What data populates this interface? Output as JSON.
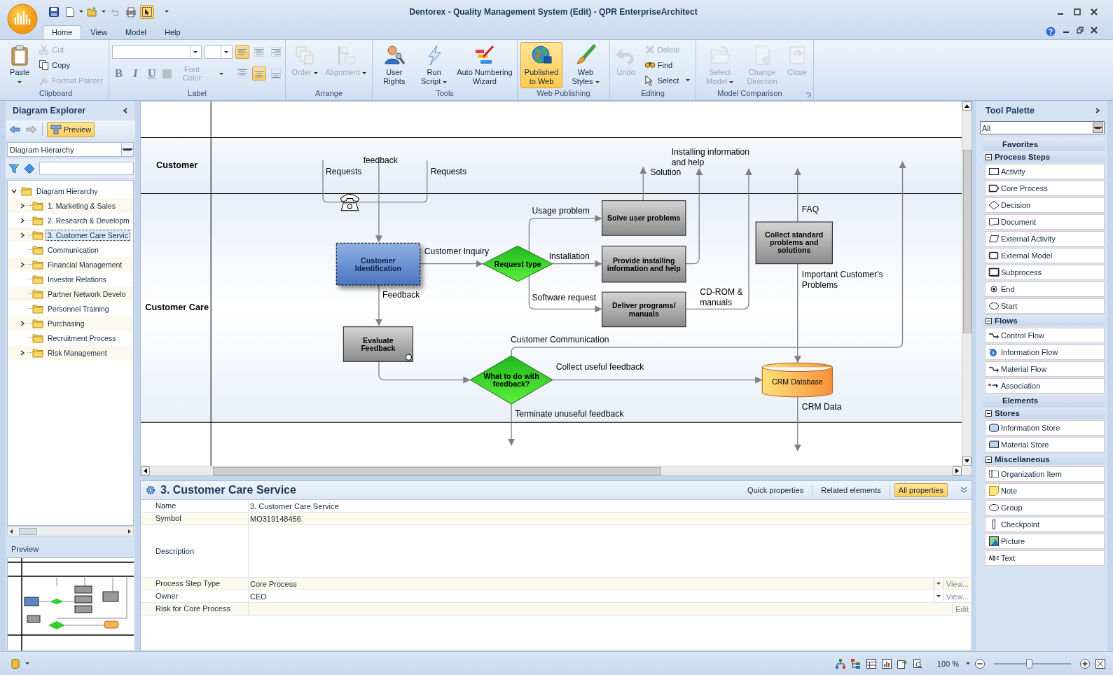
{
  "window": {
    "title": "Dentorex - Quality Management System (Edit) - QPR EnterpriseArchitect"
  },
  "quick_access": [
    {
      "disabled": false,
      "on": false
    },
    {
      "disabled": false,
      "on": false
    },
    {
      "disabled": false,
      "on": false
    },
    {
      "disabled": true,
      "on": false
    },
    {
      "disabled": false,
      "on": false
    },
    {
      "disabled": false,
      "on": true
    }
  ],
  "ribbon": {
    "tabs": [
      {
        "label": "Home",
        "selected": true
      },
      {
        "label": "View",
        "selected": false
      },
      {
        "label": "Model",
        "selected": false
      },
      {
        "label": "Help",
        "selected": false
      }
    ],
    "groups": [
      {
        "title": "Clipboard",
        "kind": "buttons",
        "buttons": [
          {
            "label": "Paste",
            "kind": "large",
            "disabled": false,
            "on": false,
            "dropdown": true
          },
          {
            "label": "Cut",
            "kind": "small",
            "disabled": true,
            "on": false,
            "dropdown": false
          },
          {
            "label": "Copy",
            "kind": "small",
            "disabled": false,
            "on": false,
            "dropdown": false
          },
          {
            "label": "Format Painter",
            "kind": "small",
            "disabled": true,
            "on": false,
            "dropdown": false
          }
        ]
      },
      {
        "title": "Label",
        "kind": "format",
        "styles": [
          {
            "label": "B",
            "disabled": true
          },
          {
            "label": "I",
            "disabled": true
          },
          {
            "label": "U",
            "disabled": true
          }
        ],
        "font_color": {
          "label": "Font Color",
          "disabled": true
        },
        "h_align": [
          {
            "selected": true
          },
          {
            "selected": false
          },
          {
            "selected": false
          }
        ],
        "v_align": [
          {
            "selected": false
          },
          {
            "selected": true
          },
          {
            "selected": false
          }
        ]
      },
      {
        "title": "Arrange",
        "kind": "buttons",
        "buttons": [
          {
            "label": "Order",
            "kind": "large",
            "disabled": true,
            "on": false,
            "dropdown": true
          },
          {
            "label": "Alignment",
            "kind": "large",
            "disabled": true,
            "on": false,
            "dropdown": true
          }
        ]
      },
      {
        "title": "Tools",
        "kind": "buttons",
        "buttons": [
          {
            "label": "User Rights",
            "kind": "large",
            "disabled": false,
            "on": false,
            "dropdown": false
          },
          {
            "label": "Run Script",
            "kind": "large",
            "disabled": false,
            "on": false,
            "dropdown": true
          },
          {
            "label": "Auto Numbering Wizard",
            "kind": "large",
            "disabled": false,
            "on": false,
            "dropdown": false
          }
        ]
      },
      {
        "title": "Web Publishing",
        "kind": "buttons",
        "buttons": [
          {
            "label": "Published to Web",
            "kind": "large",
            "disabled": false,
            "on": true,
            "dropdown": false
          },
          {
            "label": "Web Styles",
            "kind": "large",
            "disabled": false,
            "on": false,
            "dropdown": true
          }
        ]
      },
      {
        "title": "Editing",
        "kind": "buttons",
        "buttons": [
          {
            "label": "Undo",
            "kind": "large",
            "disabled": true,
            "on": false,
            "dropdown": false
          },
          {
            "label": "Delete",
            "kind": "small",
            "disabled": true,
            "on": false,
            "dropdown": false
          },
          {
            "label": "Find",
            "kind": "small",
            "disabled": false,
            "on": false,
            "dropdown": false
          },
          {
            "label": "Select",
            "kind": "small",
            "disabled": false,
            "on": false,
            "dropdown": true
          }
        ]
      },
      {
        "title": "Model Comparison",
        "kind": "buttons",
        "buttons": [
          {
            "label": "Select Model",
            "kind": "large",
            "disabled": true,
            "on": false,
            "dropdown": true
          },
          {
            "label": "Change Direction",
            "kind": "large",
            "disabled": true,
            "on": false,
            "dropdown": false
          },
          {
            "label": "Close",
            "kind": "large",
            "disabled": true,
            "on": false,
            "dropdown": false
          }
        ]
      }
    ]
  },
  "explorer": {
    "title": "Diagram Explorer",
    "preview_button": {
      "label": "Preview",
      "on": true
    },
    "view": {
      "value": "Diagram Hierarchy"
    },
    "tree": [
      {
        "label": "Diagram Hierarchy",
        "kind": "branch",
        "expanded": true,
        "selected": false,
        "children": [
          {
            "label": "1. Marketing & Sales",
            "kind": "branch",
            "expanded": false,
            "selected": false
          },
          {
            "label": "2. Research & Developm",
            "kind": "branch",
            "expanded": false,
            "selected": false
          },
          {
            "label": "3. Customer Care Servic",
            "kind": "branch",
            "expanded": false,
            "selected": true
          },
          {
            "label": "Communication",
            "kind": "leaf",
            "selected": false
          },
          {
            "label": "Financial Management",
            "kind": "branch",
            "expanded": false,
            "selected": false
          },
          {
            "label": "Investor Relations",
            "kind": "leaf",
            "selected": false
          },
          {
            "label": "Partner Network Develo",
            "kind": "leaf",
            "selected": false
          },
          {
            "label": "Personnel Training",
            "kind": "leaf",
            "selected": false
          },
          {
            "label": "Purchasing",
            "kind": "branch",
            "expanded": false,
            "selected": false
          },
          {
            "label": "Recruitment Process",
            "kind": "leaf",
            "selected": false
          },
          {
            "label": "Risk Management",
            "kind": "branch",
            "expanded": false,
            "selected": false
          }
        ]
      }
    ],
    "preview": {
      "title": "Preview"
    }
  },
  "diagram": {
    "lanes": [
      {
        "name": "Customer"
      },
      {
        "name": "Customer Care"
      }
    ],
    "nodes": [
      {
        "kind": "process",
        "label": "Customer Identification",
        "selected": true
      },
      {
        "kind": "decision",
        "label": "Request type",
        "selected": false
      },
      {
        "kind": "activity",
        "label": "Solve user problems",
        "selected": false
      },
      {
        "kind": "activity",
        "label": "Provide installing information and help",
        "selected": false
      },
      {
        "kind": "activity",
        "label": "Deliver programs/ manuals",
        "selected": false
      },
      {
        "kind": "activity",
        "label": "Collect standard problems and solutions",
        "selected": false
      },
      {
        "kind": "activity",
        "label": "Evaluate Feedback",
        "selected": false
      },
      {
        "kind": "decision",
        "label": "What to do with feedback?",
        "selected": false
      },
      {
        "kind": "store",
        "label": "CRM Database",
        "selected": false
      }
    ],
    "flow_labels": [
      "Requests",
      "feedback",
      "Requests",
      "Customer Inquiry",
      "Usage problem",
      "Installation",
      "Software request",
      "Feedback",
      "Solution",
      "Installing information and help",
      "CD-ROM & manuals",
      "FAQ",
      "Important Customer's Problems",
      "Customer Communication",
      "Collect useful feedback",
      "Terminate unuseful feedback",
      "CRM Data"
    ]
  },
  "properties": {
    "title": "3. Customer Care Service",
    "tabs": [
      {
        "label": "Quick properties",
        "selected": false
      },
      {
        "label": "Related elements",
        "selected": false
      },
      {
        "label": "All properties",
        "selected": true
      }
    ],
    "rows": [
      {
        "label": "Name",
        "value": "3. Customer Care Service",
        "kind": "text"
      },
      {
        "label": "Symbol",
        "value": "MO319148456",
        "kind": "text"
      },
      {
        "label": "Description",
        "kind": "multiline"
      },
      {
        "label": "Process Step Type",
        "value": "Core Process",
        "kind": "dropdown",
        "action": "View..."
      },
      {
        "label": "Owner",
        "value": "CEO",
        "kind": "dropdown",
        "action": "View..."
      },
      {
        "label": "Risk for Core Process",
        "kind": "button",
        "action": "Edit"
      }
    ]
  },
  "palette": {
    "title": "Tool Palette",
    "filter": {
      "value": "All"
    },
    "sections": [
      {
        "kind": "category",
        "title": "Favorites"
      },
      {
        "kind": "section",
        "title": "Process Steps",
        "expanded": true,
        "items": [
          {
            "label": "Activity"
          },
          {
            "label": "Core Process"
          },
          {
            "label": "Decision"
          },
          {
            "label": "Document"
          },
          {
            "label": "External Activity"
          },
          {
            "label": "External Model"
          },
          {
            "label": "Subprocess"
          },
          {
            "label": "End"
          },
          {
            "label": "Start"
          }
        ]
      },
      {
        "kind": "section",
        "title": "Flows",
        "expanded": true,
        "items": [
          {
            "label": "Control Flow"
          },
          {
            "label": "Information Flow"
          },
          {
            "label": "Material Flow"
          },
          {
            "label": "Association"
          }
        ]
      },
      {
        "kind": "category",
        "title": "Elements"
      },
      {
        "kind": "section",
        "title": "Stores",
        "expanded": true,
        "items": [
          {
            "label": "Information Store"
          },
          {
            "label": "Material Store"
          }
        ]
      },
      {
        "kind": "section",
        "title": "Miscellaneous",
        "expanded": true,
        "items": [
          {
            "label": "Organization Item"
          },
          {
            "label": "Note"
          },
          {
            "label": "Group"
          },
          {
            "label": "Checkpoint"
          },
          {
            "label": "Picture"
          },
          {
            "label": "Text"
          }
        ]
      }
    ]
  },
  "status_bar": {
    "zoom": {
      "value": "100 %",
      "level": 0.45
    }
  }
}
